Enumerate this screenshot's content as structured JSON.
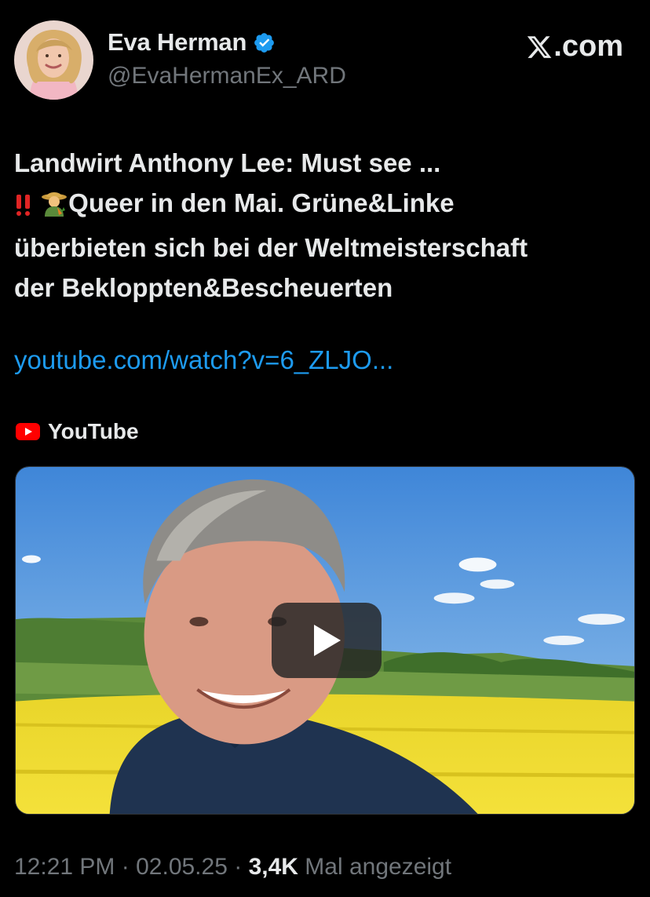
{
  "author": {
    "display_name": "Eva Herman",
    "handle": "@EvaHermanEx_ARD",
    "verified": true
  },
  "brand": {
    "logo_text": ".com",
    "logo_icon": "x-logo-icon"
  },
  "tweet": {
    "lines": [
      "Landwirt Anthony Lee:  Must see ...",
      "Queer in den Mai. Grüne&Linke",
      "überbieten sich bei der Weltmeisterschaft",
      "der Bekloppten&Bescheuerten"
    ],
    "emojis": [
      "double-exclamation-icon",
      "farmer-icon"
    ],
    "link": "youtube.com/watch?v=6_ZLJO..."
  },
  "card": {
    "source_label": "YouTube",
    "source_icon": "youtube-icon",
    "play_icon": "play-icon"
  },
  "meta": {
    "time": "12:21 PM",
    "separator": "·",
    "date": "02.05.25",
    "views_count": "3,4K",
    "views_label": "Mal angezeigt"
  },
  "colors": {
    "background": "#000000",
    "text_primary": "#e7e9ea",
    "text_secondary": "#71767b",
    "link": "#1d9bf0",
    "verified": "#1d9bf0",
    "youtube_red": "#ff0000"
  }
}
